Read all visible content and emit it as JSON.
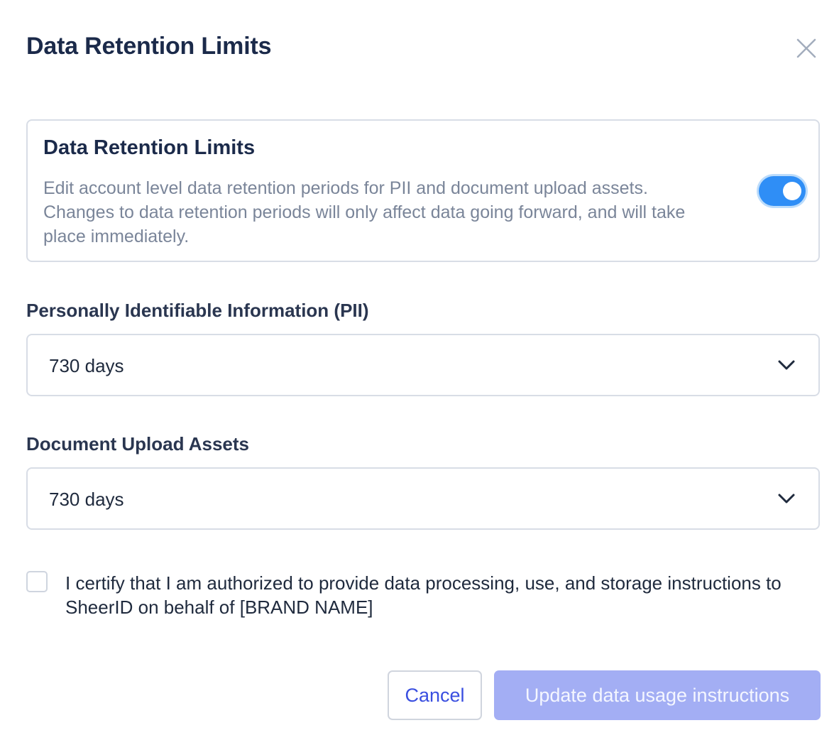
{
  "modal": {
    "title": "Data Retention Limits",
    "close_icon": "close-icon"
  },
  "toggle_card": {
    "title": "Data Retention Limits",
    "description": "Edit account level data retention periods for PII and document upload assets. Changes to data retention periods will only affect data going forward, and will take place immediately.",
    "enabled": true,
    "accent_color": "#2f8ef6"
  },
  "pii": {
    "label": "Personally Identifiable Information (PII)",
    "value": "730 days",
    "icon": "chevron-down-icon"
  },
  "documents": {
    "label": "Document Upload Assets",
    "value": "730 days",
    "icon": "chevron-down-icon"
  },
  "certify": {
    "checked": false,
    "label": "I certify that I am authorized to provide data processing, use, and storage instructions to SheerID on behalf of [BRAND NAME]"
  },
  "actions": {
    "cancel_label": "Cancel",
    "submit_label": "Update data usage instructions",
    "submit_disabled": true,
    "cancel_color": "#3a4fe0",
    "submit_color": "#a3aef4"
  }
}
